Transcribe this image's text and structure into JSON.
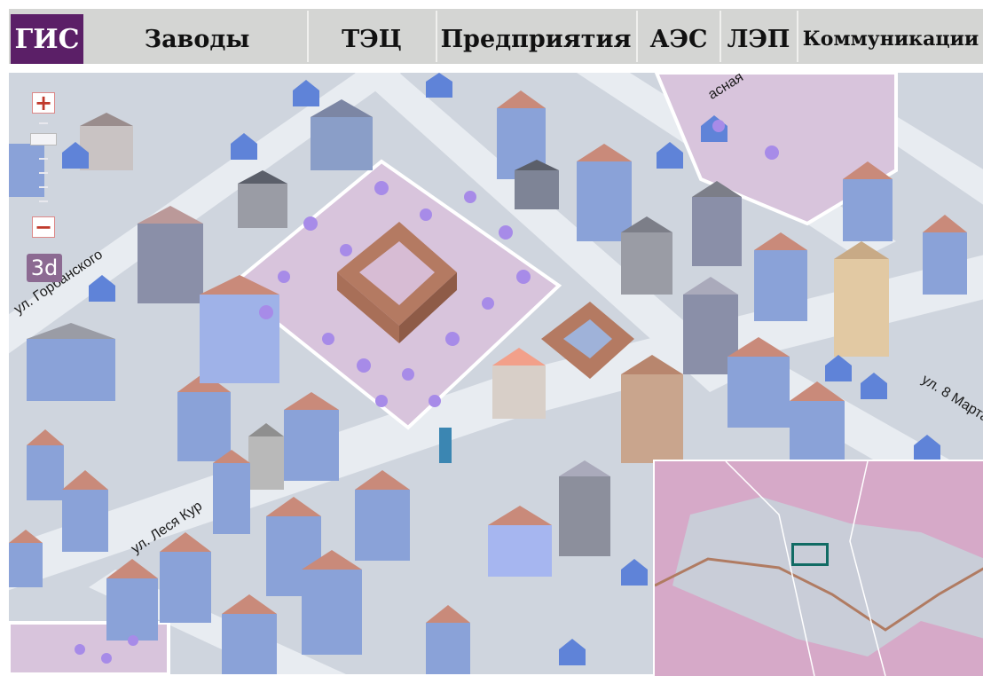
{
  "nav": {
    "logo_label": "ГИС",
    "items": [
      "Заводы",
      "ТЭЦ",
      "Предприятия",
      "АЭС",
      "ЛЭП",
      "Коммуникации"
    ]
  },
  "map_controls": {
    "zoom_in": "+",
    "zoom_out": "−",
    "mode_3d": "3d"
  },
  "streets": {
    "gorbanskogo": "ул. Горбанского",
    "lesya": "ул. Леся Кур",
    "march8": "ул. 8 Марта",
    "top_right": "асная"
  },
  "colors": {
    "brand": "#5b1f67",
    "nav_bg": "#d4d5d3",
    "park": "#d8c4dc",
    "road": "#e8ecf1",
    "block": "#cfd5de",
    "minimap": "#d6a9c8",
    "minimap_marker": "#116b64"
  }
}
